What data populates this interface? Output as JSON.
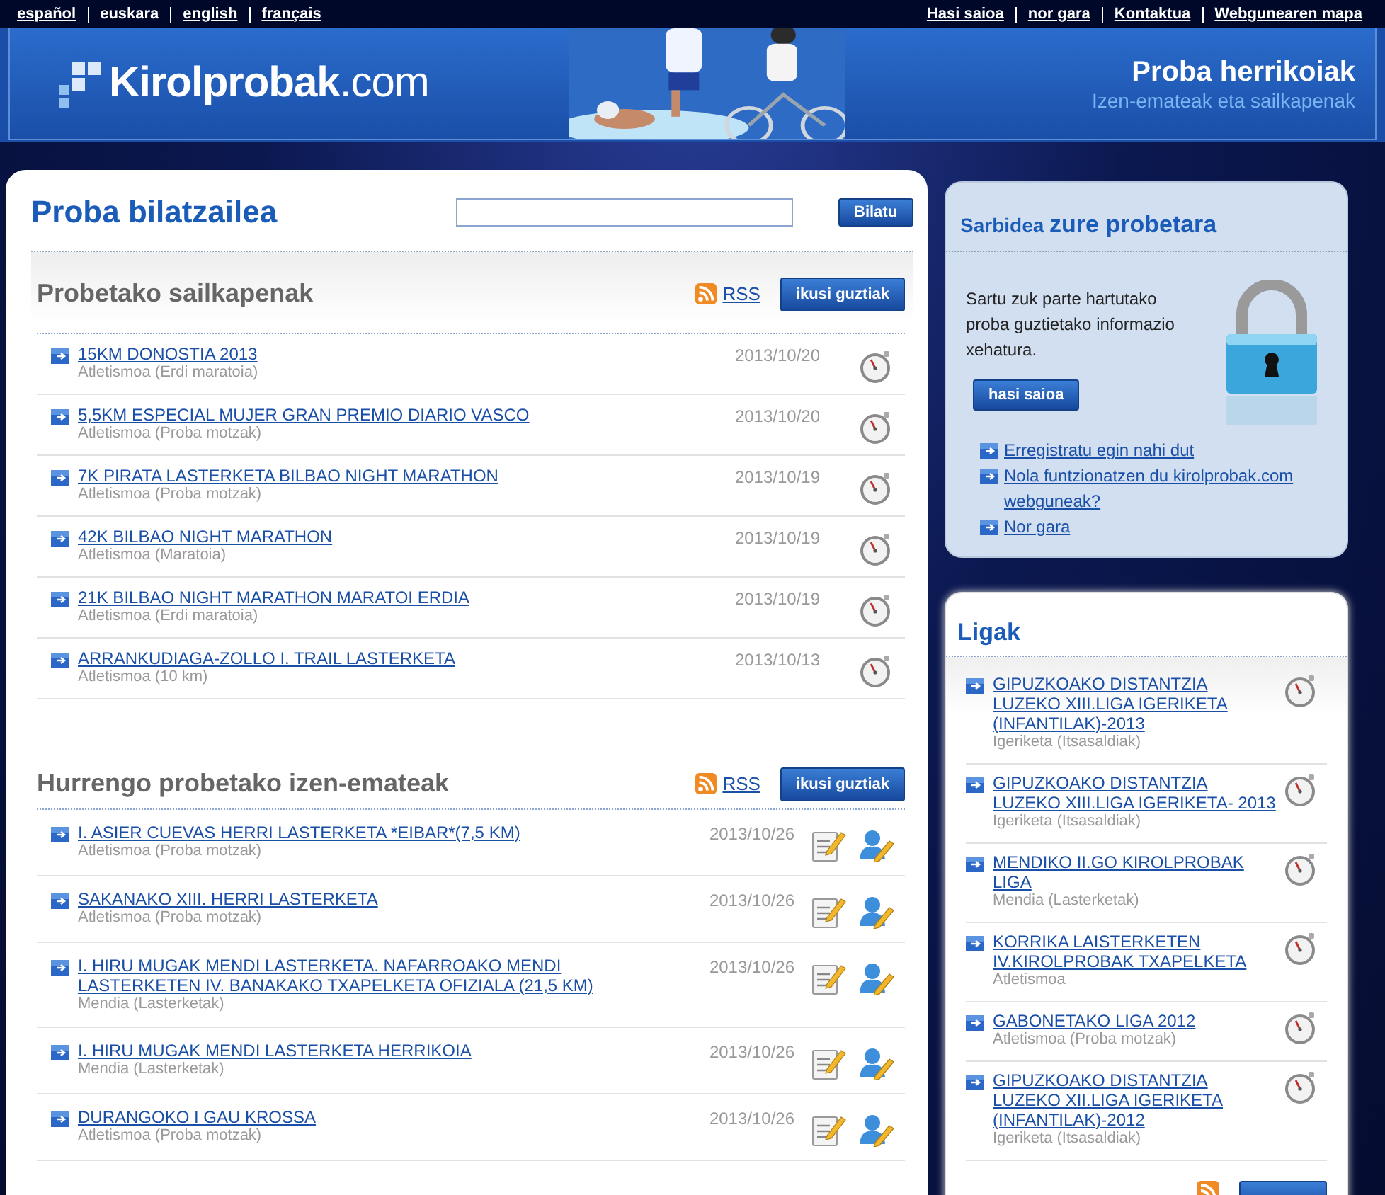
{
  "languages": [
    {
      "label": "español",
      "selected": false
    },
    {
      "label": "euskara",
      "selected": true
    },
    {
      "label": "english",
      "selected": false
    },
    {
      "label": "français",
      "selected": false
    }
  ],
  "top_links": [
    "Hasi saioa",
    "nor gara",
    "Kontaktua",
    "Webgunearen mapa"
  ],
  "header": {
    "logo": "**Kirolprobak**.com",
    "title": "Proba herrikoiak",
    "subtitle": "Izen-emateak eta sailkapenak"
  },
  "search": {
    "title": "Proba bilatzailea",
    "button": "Bilatu"
  },
  "sections": [
    {
      "title": "Probetako sailkapenak",
      "rss": "RSS",
      "button": "ikusi guztiak",
      "kind": "results",
      "rows": [
        {
          "title": "15KM DONOSTIA 2013",
          "category": "Atletismoa (Erdi maratoia)",
          "date": "2013/10/20"
        },
        {
          "title": "5,5KM ESPECIAL MUJER GRAN PREMIO DIARIO VASCO",
          "category": "Atletismoa (Proba motzak)",
          "date": "2013/10/20"
        },
        {
          "title": "7K PIRATA LASTERKETA BILBAO NIGHT MARATHON",
          "category": "Atletismoa (Proba motzak)",
          "date": "2013/10/19"
        },
        {
          "title": "42K BILBAO NIGHT MARATHON",
          "category": "Atletismoa (Maratoia)",
          "date": "2013/10/19"
        },
        {
          "title": "21K BILBAO NIGHT MARATHON MARATOI ERDIA",
          "category": "Atletismoa (Erdi maratoia)",
          "date": "2013/10/19"
        },
        {
          "title": "ARRANKUDIAGA-ZOLLO I. TRAIL LASTERKETA",
          "category": "Atletismoa (10 km)",
          "date": "2013/10/13"
        }
      ]
    },
    {
      "title": "Hurrengo probetako izen-emateak",
      "rss": "RSS",
      "button": "ikusi guztiak",
      "kind": "registration",
      "rows": [
        {
          "title": "I. ASIER CUEVAS HERRI LASTERKETA *EIBAR*(7,5 KM)",
          "category": "Atletismoa (Proba motzak)",
          "date": "2013/10/26"
        },
        {
          "title": "SAKANAKO XIII. HERRI LASTERKETA",
          "category": "Atletismoa (Proba motzak)",
          "date": "2013/10/26"
        },
        {
          "title": "I. HIRU MUGAK MENDI LASTERKETA. NAFARROAKO MENDI LASTERKETEN IV. BANAKAKO TXAPELKETA OFIZIALA (21,5 KM)",
          "category": "Mendia (Lasterketak)",
          "date": "2013/10/26"
        },
        {
          "title": "I. HIRU MUGAK MENDI LASTERKETA HERRIKOIA",
          "category": "Mendia (Lasterketak)",
          "date": "2013/10/26"
        },
        {
          "title": "DURANGOKO I GAU KROSSA",
          "category": "Atletismoa (Proba motzak)",
          "date": "2013/10/26"
        }
      ]
    }
  ],
  "access": {
    "title": "Sarbidea **zure probetara**",
    "text": "Sartu zuk parte hartutako proba guztietako informazio xehatura.",
    "button": "hasi saioa",
    "links": [
      "Erregistratu egin nahi dut",
      "Nola funtzionatzen du kirolprobak.com webguneak?",
      "Nor gara"
    ]
  },
  "leagues": {
    "title": "Ligak",
    "rows": [
      {
        "title": "GIPUZKOAKO DISTANTZIA LUZEKO XIII.LIGA IGERIKETA (INFANTILAK)-2013",
        "category": "Igeriketa (Itsasaldiak)"
      },
      {
        "title": "GIPUZKOAKO DISTANTZIA LUZEKO XIII.LIGA IGERIKETA- 2013",
        "category": "Igeriketa (Itsasaldiak)"
      },
      {
        "title": "MENDIKO II.GO KIROLPROBAK LIGA",
        "category": "Mendia (Lasterketak)"
      },
      {
        "title": "KORRIKA LAISTERKETEN IV.KIROLPROBAK TXAPELKETA",
        "category": "Atletismoa"
      },
      {
        "title": "GABONETAKO LIGA 2012",
        "category": "Atletismoa (Proba motzak)"
      },
      {
        "title": "GIPUZKOAKO DISTANTZIA LUZEKO XII.LIGA IGERIKETA (INFANTILAK)-2012",
        "category": "Igeriketa (Itsasaldiak)"
      }
    ]
  }
}
